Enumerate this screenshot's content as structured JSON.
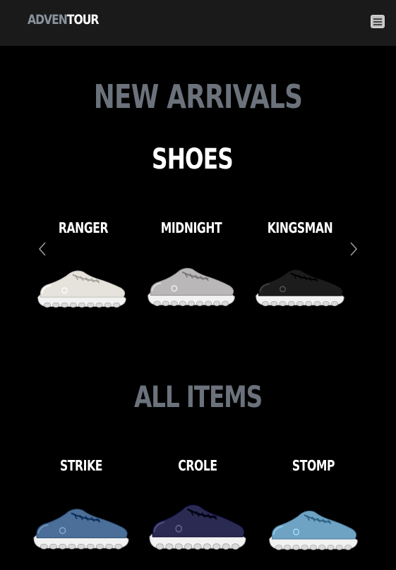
{
  "nav": {
    "brand_part1": "ADVEN",
    "brand_part2": "TOUR",
    "menu_icon": "hamburger-menu-icon"
  },
  "new_arrivals": {
    "title": "NEW ARRIVALS",
    "subtitle": "SHOES",
    "prev_icon": "chevron-left-icon",
    "next_icon": "chevron-right-icon",
    "items": [
      {
        "name": "RANGER",
        "color": "#e6e2dc"
      },
      {
        "name": "MIDNIGHT",
        "color": "#b9b7b8"
      },
      {
        "name": "KINGSMAN",
        "color": "#1c1c1c"
      }
    ]
  },
  "all_items": {
    "title": "ALL ITEMS",
    "items": [
      {
        "name": "STRIKE",
        "color": "#4b6f98"
      },
      {
        "name": "CROLE",
        "color": "#2b2a52"
      },
      {
        "name": "STOMP",
        "color": "#6fa3c4"
      }
    ]
  },
  "colors": {
    "navbar_bg": "#1a1a1a",
    "page_bg": "#000000",
    "muted_heading": "#6b727b"
  }
}
